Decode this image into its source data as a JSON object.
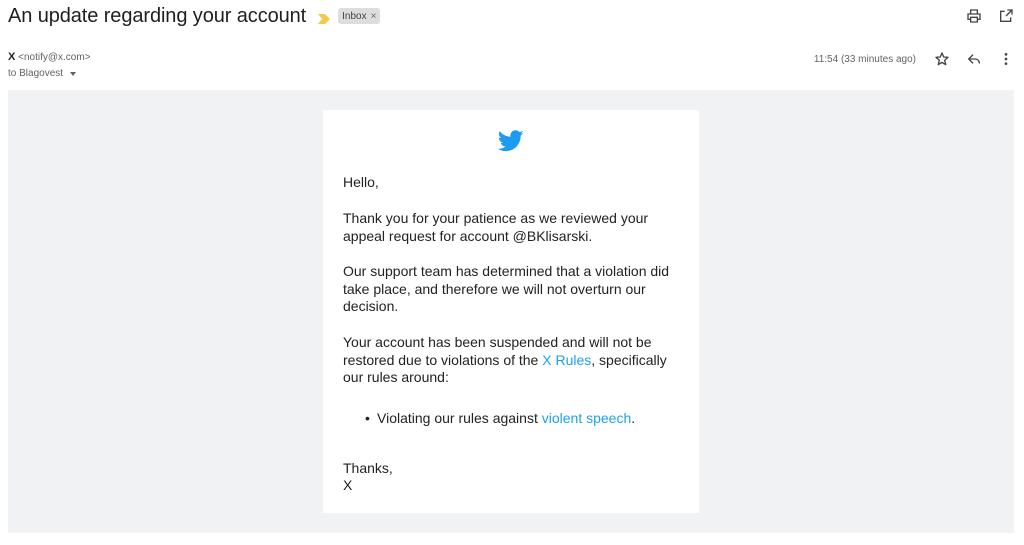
{
  "subject": "An update regarding your account",
  "label": {
    "name": "Inbox",
    "remove": "×"
  },
  "sender": {
    "name": "X",
    "email": "<notify@x.com>"
  },
  "recipient": "to Blagovest",
  "timestamp": "11:54 (33 minutes ago)",
  "icons": {
    "importance": "importance-marker-icon",
    "print": "print-icon",
    "popout": "open-in-new-window-icon",
    "star": "star-icon",
    "reply": "reply-icon",
    "more": "more-vert-icon",
    "logo": "twitter-bird-icon"
  },
  "colors": {
    "accent_link": "#1da1f2",
    "importance": "#f2c94c",
    "bird": "#1d9bf0"
  },
  "email": {
    "greeting": "Hello,",
    "paragraph1": "Thank you for your patience as we reviewed your appeal request for account @BKlisarski.",
    "paragraph2": "Our support team has determined that a violation did take place, and therefore we will not overturn our decision.",
    "paragraph3_pre": "Your account has been suspended and will not be restored due to violations of the ",
    "paragraph3_link": "X Rules",
    "paragraph3_post": ", specifically our rules around:",
    "bullet_pre": "Violating our rules against ",
    "bullet_link": "violent speech",
    "bullet_post": ".",
    "closing": "Thanks,",
    "signature": "X"
  }
}
